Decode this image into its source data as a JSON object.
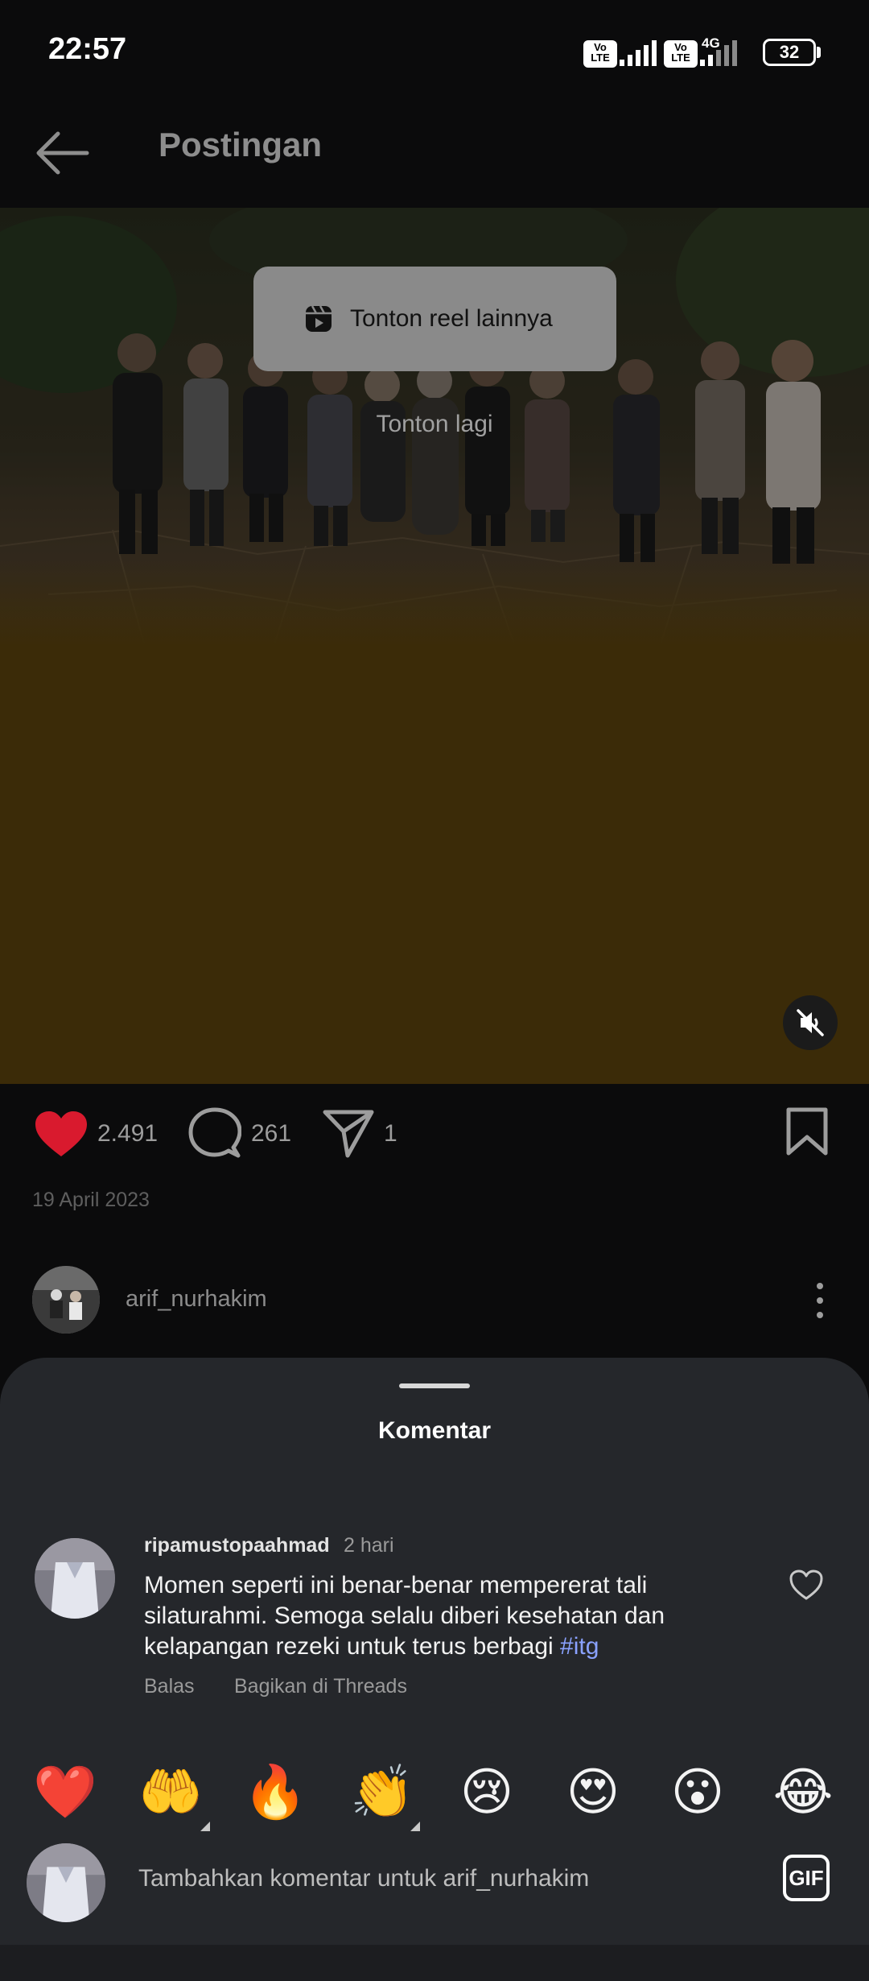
{
  "status_bar": {
    "time": "22:57",
    "network": "4G",
    "battery": "32"
  },
  "header": {
    "title": "Postingan"
  },
  "media": {
    "reel_button_label": "Tonton reel lainnya",
    "replay_label": "Tonton lagi"
  },
  "actions": {
    "likes": "2.491",
    "comments": "261",
    "shares": "1"
  },
  "post": {
    "date": "19 April 2023",
    "author": "arif_nurhakim"
  },
  "comments_sheet": {
    "title": "Komentar",
    "comment": {
      "username": "ripamustopaahmad",
      "time": "2 hari",
      "text": "Momen seperti ini benar-benar mempererat tali silaturahmi. Semoga selalu diberi kesehatan dan kelapangan rezeki untuk terus berbagi ",
      "hashtag": "#itg",
      "reply_label": "Balas",
      "share_threads_label": "Bagikan di Threads"
    },
    "quick_reactions": [
      "❤️",
      "🤲",
      "🔥",
      "👏",
      "😢",
      "😍",
      "😮",
      "😂"
    ],
    "composer_placeholder": "Tambahkan komentar untuk arif_nurhakim",
    "gif_label": "GIF"
  },
  "colors": {
    "like_red": "#d91a2e",
    "hashtag_blue": "#8aa2ff",
    "video_tint": "#3b2b08"
  }
}
